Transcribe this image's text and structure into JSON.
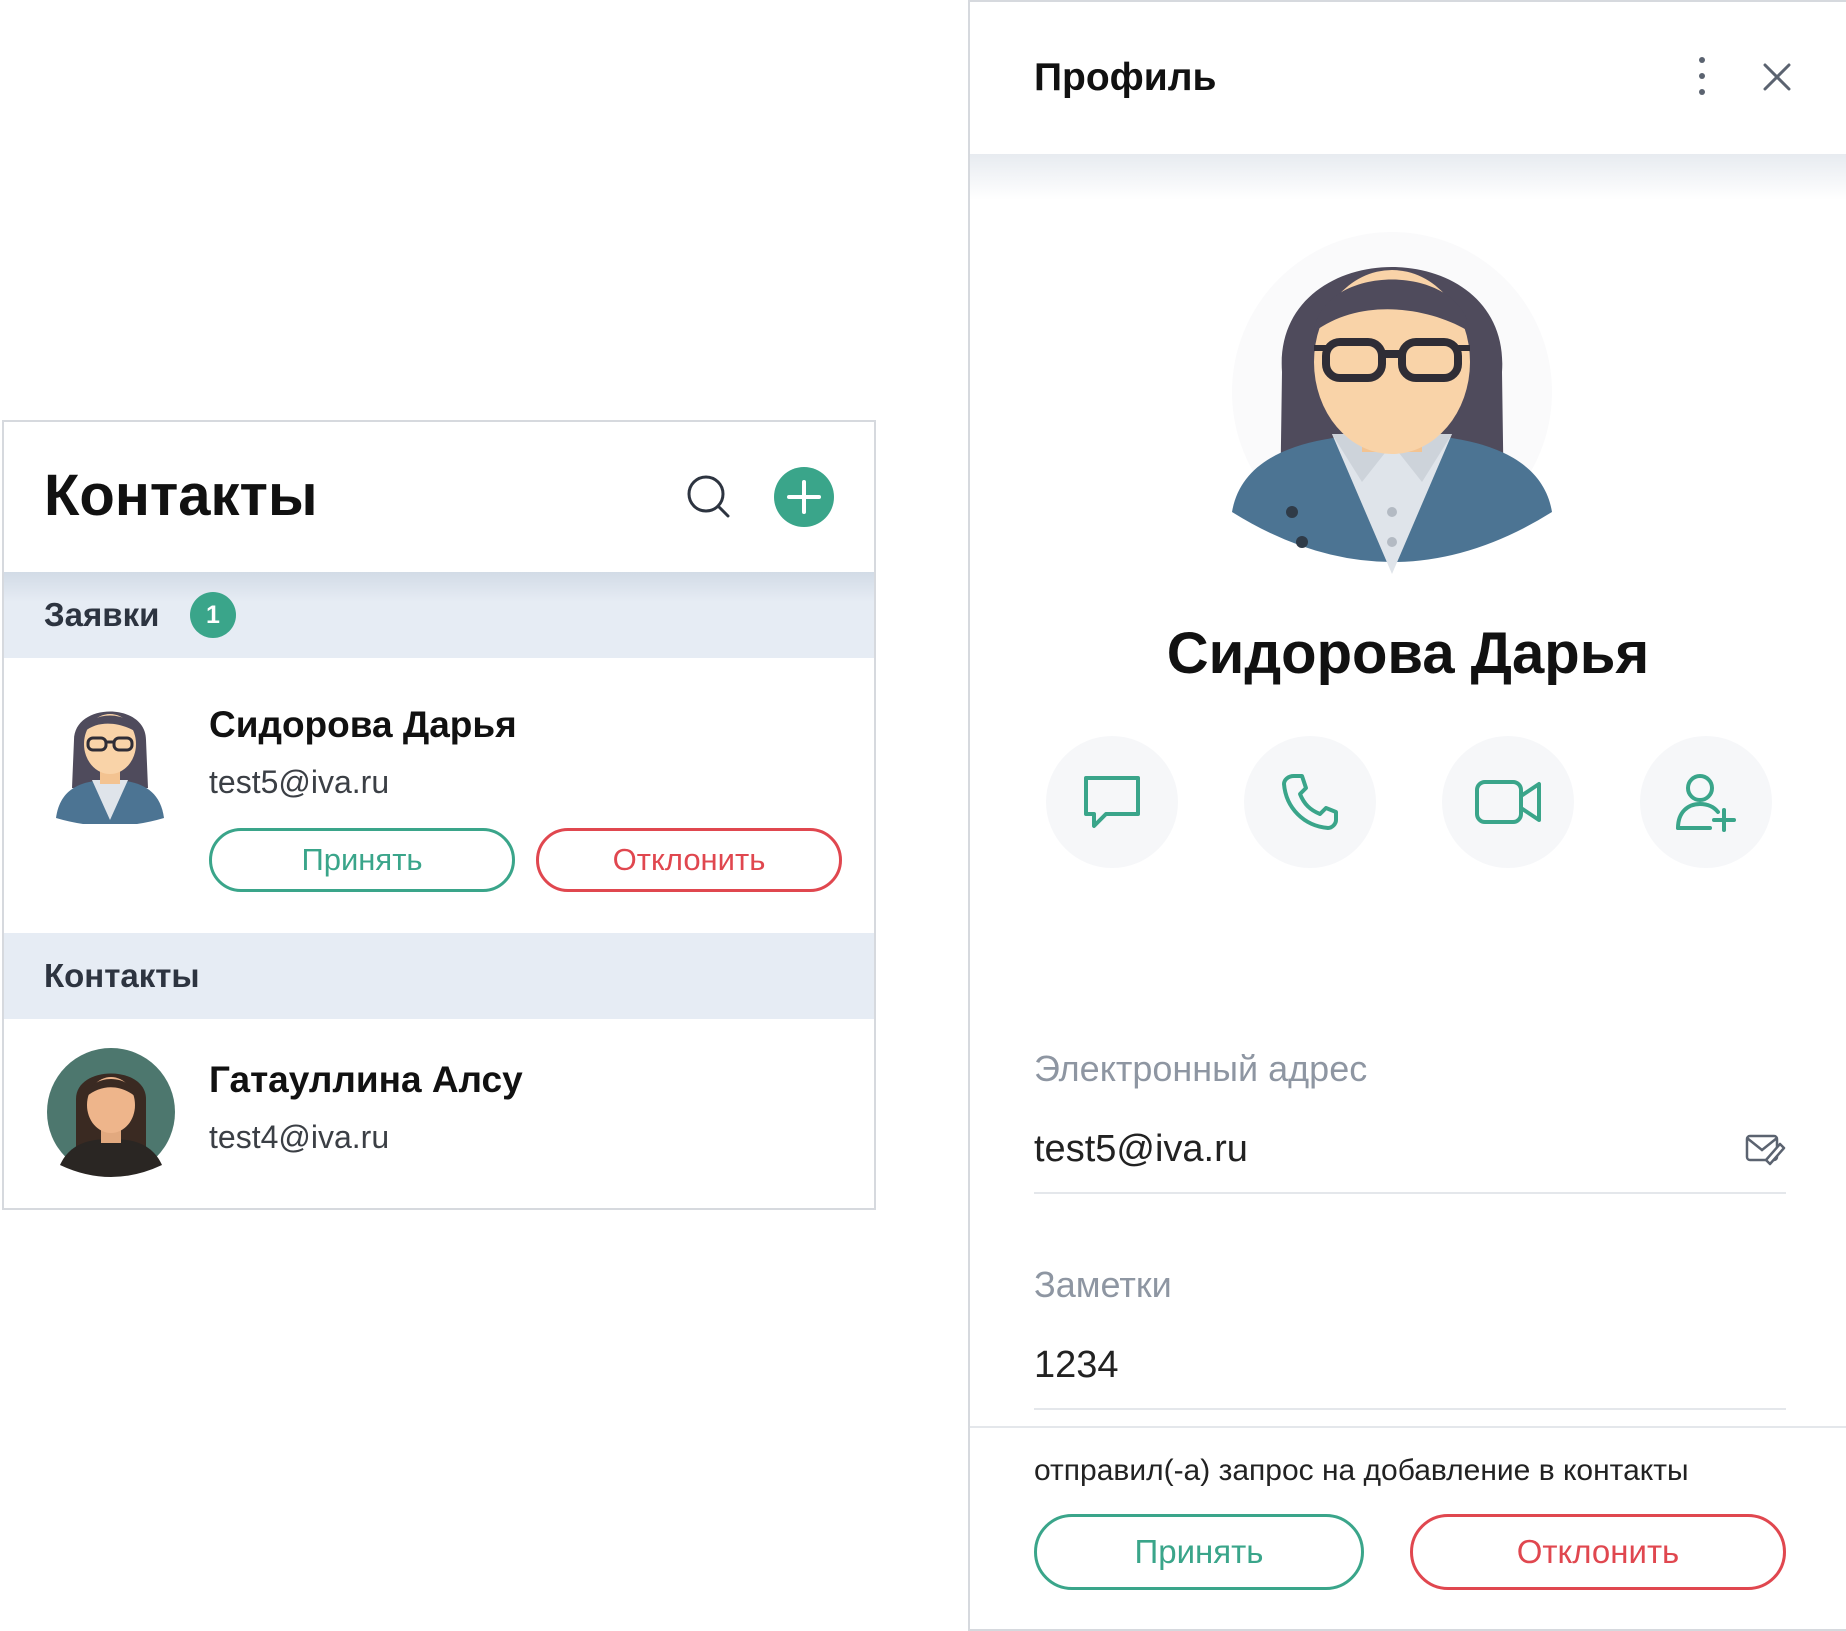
{
  "contacts_panel": {
    "title": "Контакты",
    "requests_section": {
      "label": "Заявки",
      "badge_count": "1",
      "items": [
        {
          "name": "Сидорова Дарья",
          "email": "test5@iva.ru",
          "accept_label": "Принять",
          "decline_label": "Отклонить"
        }
      ]
    },
    "contacts_section": {
      "label": "Контакты",
      "items": [
        {
          "name": "Гатауллина Алсу",
          "email": "test4@iva.ru"
        }
      ]
    }
  },
  "profile_panel": {
    "title": "Профиль",
    "name": "Сидорова Дарья",
    "actions": [
      "chat-icon",
      "phone-icon",
      "video-icon",
      "add-contact-icon"
    ],
    "email_label": "Электронный адрес",
    "email_value": "test5@iva.ru",
    "notes_label": "Заметки",
    "notes_value": "1234",
    "request_text": "отправил(-а) запрос на добавление в контакты",
    "accept_label": "Принять",
    "decline_label": "Отклонить"
  },
  "colors": {
    "accent": "#3aa58a",
    "decline": "#e0474f",
    "section_band": "#e6ecf4",
    "muted_text": "#8e96a2"
  }
}
